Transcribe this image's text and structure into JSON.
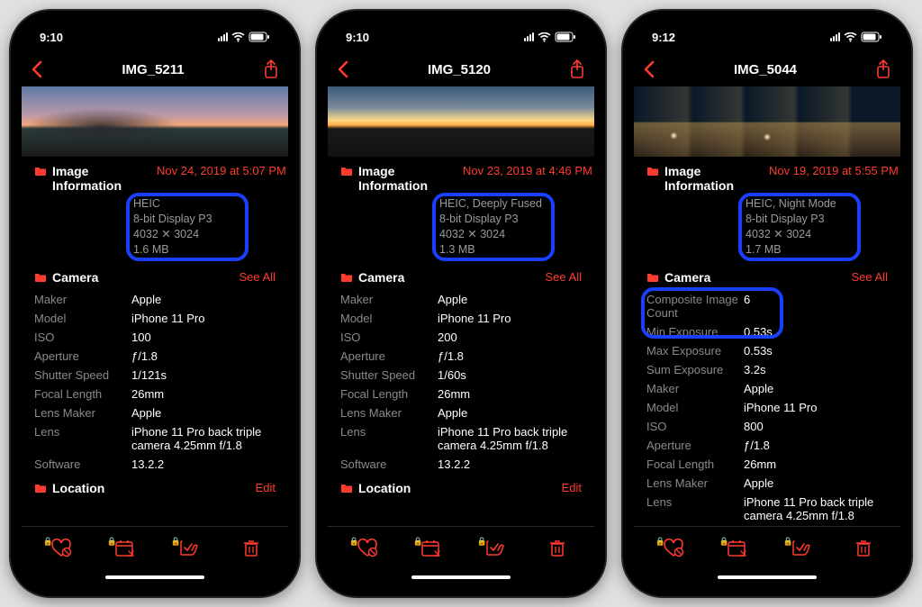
{
  "phones": [
    {
      "time": "9:10",
      "title": "IMG_5211",
      "thumbClass": "sunset1",
      "imageInfo": {
        "heading": "Image Information",
        "date": "Nov 24, 2019 at 5:07 PM",
        "lines": [
          "HEIC",
          "8-bit Display P3",
          "4032 ✕ 3024",
          "1.6 MB"
        ]
      },
      "camera": {
        "heading": "Camera",
        "seeAll": "See All",
        "rows": [
          {
            "k": "Maker",
            "v": "Apple"
          },
          {
            "k": "Model",
            "v": "iPhone 11 Pro"
          },
          {
            "k": "ISO",
            "v": "100"
          },
          {
            "k": "Aperture",
            "v": "ƒ/1.8"
          },
          {
            "k": "Shutter Speed",
            "v": "1/121s"
          },
          {
            "k": "Focal Length",
            "v": "26mm"
          },
          {
            "k": "Lens Maker",
            "v": "Apple"
          },
          {
            "k": "Lens",
            "v": "iPhone 11 Pro back triple camera 4.25mm f/1.8"
          },
          {
            "k": "Software",
            "v": "13.2.2"
          }
        ]
      },
      "location": {
        "heading": "Location",
        "action": "Edit"
      }
    },
    {
      "time": "9:10",
      "title": "IMG_5120",
      "thumbClass": "sunset2",
      "imageInfo": {
        "heading": "Image Information",
        "date": "Nov 23, 2019 at 4:46 PM",
        "lines": [
          "HEIC, Deeply Fused",
          "8-bit Display P3",
          "4032 ✕ 3024",
          "1.3 MB"
        ]
      },
      "camera": {
        "heading": "Camera",
        "seeAll": "See All",
        "rows": [
          {
            "k": "Maker",
            "v": "Apple"
          },
          {
            "k": "Model",
            "v": "iPhone 11 Pro"
          },
          {
            "k": "ISO",
            "v": "200"
          },
          {
            "k": "Aperture",
            "v": "ƒ/1.8"
          },
          {
            "k": "Shutter Speed",
            "v": "1/60s"
          },
          {
            "k": "Focal Length",
            "v": "26mm"
          },
          {
            "k": "Lens Maker",
            "v": "Apple"
          },
          {
            "k": "Lens",
            "v": "iPhone 11 Pro back triple camera 4.25mm f/1.8"
          },
          {
            "k": "Software",
            "v": "13.2.2"
          }
        ]
      },
      "location": {
        "heading": "Location",
        "action": "Edit"
      }
    },
    {
      "time": "9:12",
      "title": "IMG_5044",
      "thumbClass": "night",
      "imageInfo": {
        "heading": "Image Information",
        "date": "Nov 19, 2019 at 5:55 PM",
        "lines": [
          "HEIC, Night Mode",
          "8-bit Display P3",
          "4032 ✕ 3024",
          "1.7 MB"
        ]
      },
      "camera": {
        "heading": "Camera",
        "seeAll": "See All",
        "highlightFirst": true,
        "rows": [
          {
            "k": "Composite Image Count",
            "v": "6"
          },
          {
            "k": "Min Exposure",
            "v": "0.53s"
          },
          {
            "k": "Max Exposure",
            "v": "0.53s"
          },
          {
            "k": "Sum Exposure",
            "v": "3.2s"
          },
          {
            "k": "Maker",
            "v": "Apple"
          },
          {
            "k": "Model",
            "v": "iPhone 11 Pro"
          },
          {
            "k": "ISO",
            "v": "800"
          },
          {
            "k": "Aperture",
            "v": "ƒ/1.8"
          },
          {
            "k": "Focal Length",
            "v": "26mm"
          },
          {
            "k": "Lens Maker",
            "v": "Apple"
          },
          {
            "k": "Lens",
            "v": "iPhone 11 Pro back triple camera 4.25mm f/1.8"
          }
        ]
      },
      "location": null
    }
  ]
}
